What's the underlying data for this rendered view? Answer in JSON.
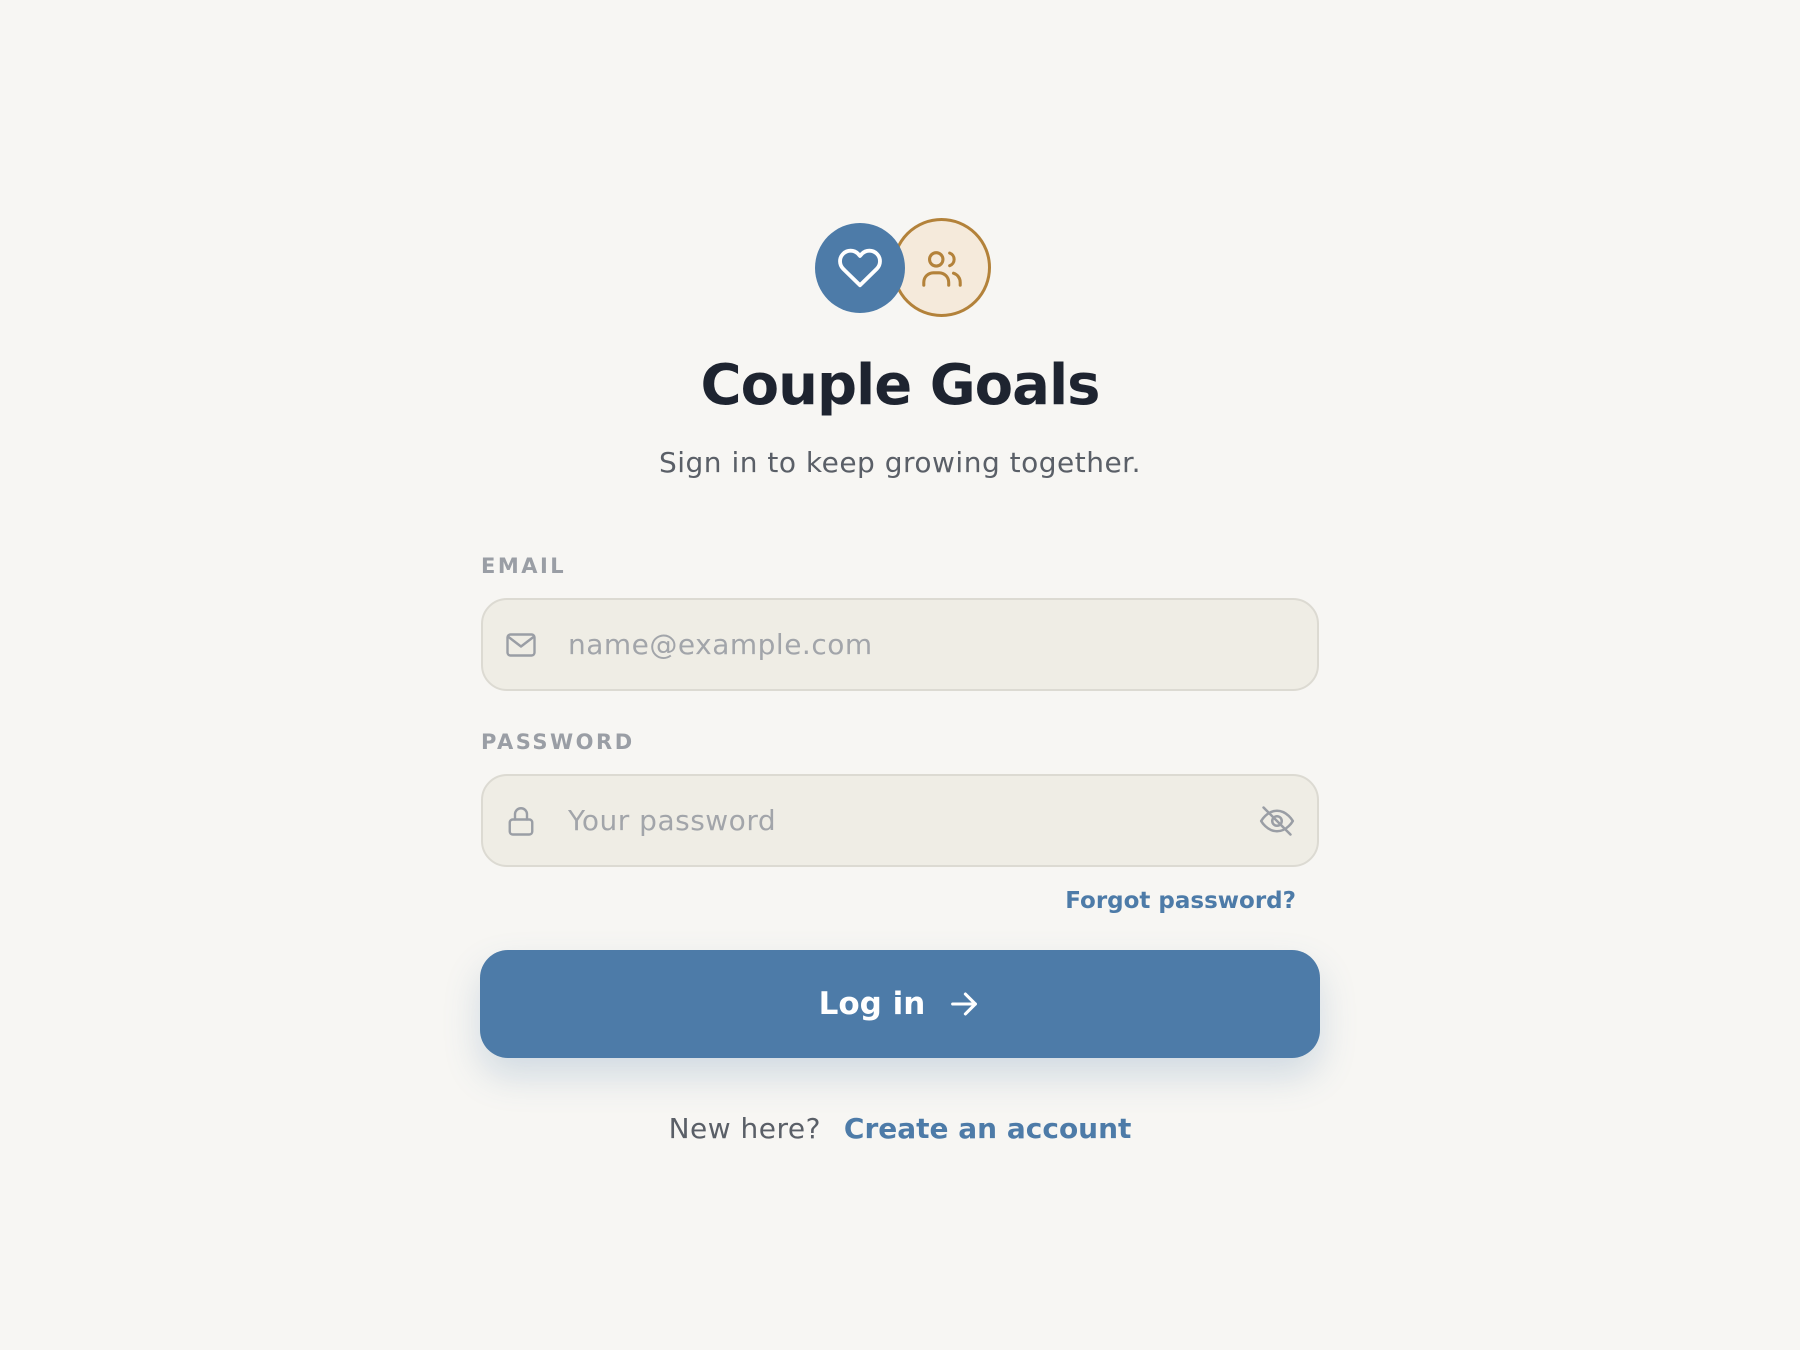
{
  "app": {
    "title": "Couple Goals",
    "subtitle": "Sign in to keep growing together."
  },
  "logo": {
    "primary_icon": "heart-icon",
    "secondary_icon": "users-icon"
  },
  "form": {
    "email": {
      "label": "EMAIL",
      "placeholder": "name@example.com",
      "value": "",
      "icon": "mail-icon"
    },
    "password": {
      "label": "PASSWORD",
      "placeholder": "Your password",
      "value": "",
      "icon": "lock-icon",
      "toggle_icon": "eye-off-icon"
    },
    "forgot_label": "Forgot password?",
    "submit_label": "Log in",
    "submit_icon": "arrow-right-icon"
  },
  "signup": {
    "prompt": "New here?",
    "link_label": "Create an account"
  },
  "colors": {
    "background": "#f7f6f3",
    "accent": "#4d7ba8",
    "secondary_accent": "#b3823a",
    "title": "#1e2430",
    "muted_text": "#5a5f67",
    "field_background": "#efede5"
  }
}
